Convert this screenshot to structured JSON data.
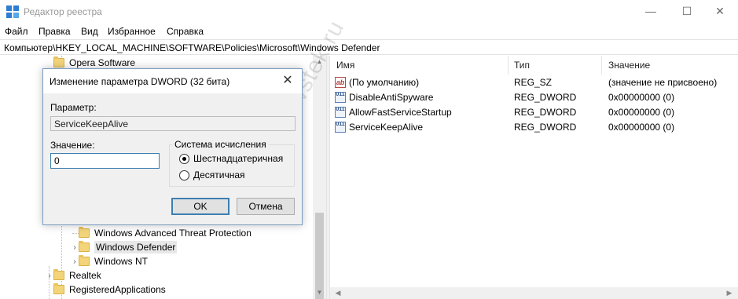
{
  "window": {
    "title": "Редактор реестра",
    "minimize_glyph": "—",
    "maximize_glyph": "☐",
    "close_glyph": "✕"
  },
  "menu": [
    "Файл",
    "Правка",
    "Вид",
    "Избранное",
    "Справка"
  ],
  "address": "Компьютер\\HKEY_LOCAL_MACHINE\\SOFTWARE\\Policies\\Microsoft\\Windows Defender",
  "tree": {
    "items": [
      {
        "label": "Opera Software"
      },
      {
        "label": "Windows Advanced Threat Protection"
      },
      {
        "label": "Windows Defender",
        "selected": true
      },
      {
        "label": "Windows NT"
      },
      {
        "label": "Realtek"
      },
      {
        "label": "RegisteredApplications"
      }
    ]
  },
  "list": {
    "columns": [
      "Имя",
      "Тип",
      "Значение"
    ],
    "rows": [
      {
        "icon": "ab",
        "name": "(По умолчанию)",
        "type": "REG_SZ",
        "value": "(значение не присвоено)"
      },
      {
        "icon": "011",
        "name": "DisableAntiSpyware",
        "type": "REG_DWORD",
        "value": "0x00000000 (0)"
      },
      {
        "icon": "011",
        "name": "AllowFastServiceStartup",
        "type": "REG_DWORD",
        "value": "0x00000000 (0)"
      },
      {
        "icon": "011",
        "name": "ServiceKeepAlive",
        "type": "REG_DWORD",
        "value": "0x00000000 (0)"
      }
    ]
  },
  "dialog": {
    "title": "Изменение параметра DWORD (32 бита)",
    "name_label": "Параметр:",
    "name_value": "ServiceKeepAlive",
    "value_label": "Значение:",
    "value": "0",
    "base_legend": "Система исчисления",
    "radio_hex": "Шестнадцатеричная",
    "radio_dec": "Десятичная",
    "ok": "OK",
    "cancel": "Отмена",
    "close_glyph": "✕"
  },
  "watermark": "windowstek.ru"
}
